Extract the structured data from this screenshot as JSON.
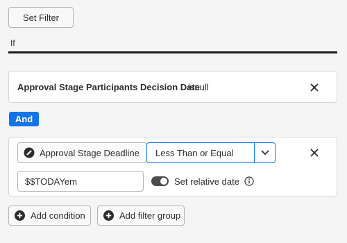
{
  "toolbar": {
    "set_filter_label": "Set Filter"
  },
  "if_label": "If",
  "condition1": {
    "field": "Approval Stage Participants Decision Date",
    "operator": "isnull"
  },
  "conjunction": "And",
  "condition2": {
    "field": "Approval Stage Deadline",
    "operator": "Less Than or Equal",
    "value": "$$TODAYem",
    "relative_date_label": "Set relative date",
    "relative_date_on": true
  },
  "actions": {
    "add_condition_label": "Add condition",
    "add_filter_group_label": "Add filter group"
  },
  "colors": {
    "accent": "#1473e6",
    "toggle_on": "#4b4b4b"
  }
}
